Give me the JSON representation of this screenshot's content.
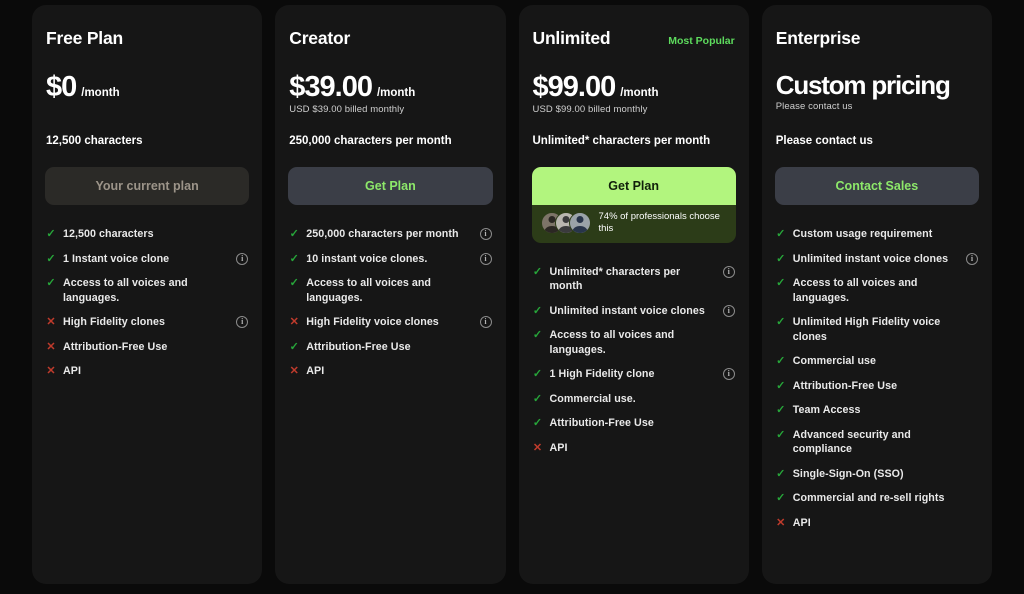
{
  "page": {
    "background": "#0a0a0a",
    "card_background": "#161616",
    "accent_green": "#b2f57e",
    "badge_green": "#5ddb5d",
    "check_green": "#27a63a",
    "cross_red": "#bf3b2c"
  },
  "plans": [
    {
      "name": "Free Plan",
      "badge": "",
      "price": "$0",
      "period": "/month",
      "price_sub": "",
      "quota": "12,500 characters",
      "cta_label": "Your current plan",
      "cta_style": "disabled",
      "social_proof": null,
      "features": [
        {
          "mark": "yes",
          "text": "12,500 characters",
          "info": false
        },
        {
          "mark": "yes",
          "text": "1 Instant voice clone",
          "info": true
        },
        {
          "mark": "yes",
          "text": "Access to all voices and languages.",
          "info": false
        },
        {
          "mark": "no",
          "text": "High Fidelity clones",
          "info": true
        },
        {
          "mark": "no",
          "text": "Attribution-Free Use",
          "info": false
        },
        {
          "mark": "no",
          "text": "API",
          "info": false
        }
      ]
    },
    {
      "name": "Creator",
      "badge": "",
      "price": "$39.00",
      "period": "/month",
      "price_sub": "USD $39.00 billed monthly",
      "quota": "250,000 characters per month",
      "cta_label": "Get Plan",
      "cta_style": "neutral",
      "social_proof": null,
      "features": [
        {
          "mark": "yes",
          "text": "250,000 characters per month",
          "info": true
        },
        {
          "mark": "yes",
          "text": "10 instant voice clones.",
          "info": true
        },
        {
          "mark": "yes",
          "text": "Access to all voices and languages.",
          "info": false
        },
        {
          "mark": "no",
          "text": "High Fidelity voice clones",
          "info": true
        },
        {
          "mark": "yes",
          "text": "Attribution-Free Use",
          "info": false
        },
        {
          "mark": "no",
          "text": "API",
          "info": false
        }
      ]
    },
    {
      "name": "Unlimited",
      "badge": "Most Popular",
      "price": "$99.00",
      "period": "/month",
      "price_sub": "USD $99.00 billed monthly",
      "quota": "Unlimited* characters per month",
      "cta_label": "Get Plan",
      "cta_style": "primary",
      "social_proof": "74% of professionals choose this",
      "features": [
        {
          "mark": "yes",
          "text": "Unlimited* characters per month",
          "info": true
        },
        {
          "mark": "yes",
          "text": "Unlimited instant voice clones",
          "info": true
        },
        {
          "mark": "yes",
          "text": "Access to all voices and languages.",
          "info": false
        },
        {
          "mark": "yes",
          "text": "1 High Fidelity clone",
          "info": true
        },
        {
          "mark": "yes",
          "text": "Commercial use.",
          "info": false
        },
        {
          "mark": "yes",
          "text": "Attribution-Free Use",
          "info": false
        },
        {
          "mark": "no",
          "text": "API",
          "info": false
        }
      ]
    },
    {
      "name": "Enterprise",
      "badge": "",
      "price": "Custom pricing",
      "period": "",
      "price_sub": "Please contact us",
      "quota": "Please contact us",
      "cta_label": "Contact Sales",
      "cta_style": "neutral",
      "social_proof": null,
      "features": [
        {
          "mark": "yes",
          "text": "Custom usage requirement",
          "info": false
        },
        {
          "mark": "yes",
          "text": "Unlimited instant voice clones",
          "info": true
        },
        {
          "mark": "yes",
          "text": "Access to all voices and languages.",
          "info": false
        },
        {
          "mark": "yes",
          "text": "Unlimited High Fidelity voice clones",
          "info": false
        },
        {
          "mark": "yes",
          "text": "Commercial use",
          "info": false
        },
        {
          "mark": "yes",
          "text": "Attribution-Free Use",
          "info": false
        },
        {
          "mark": "yes",
          "text": "Team Access",
          "info": false
        },
        {
          "mark": "yes",
          "text": "Advanced security and compliance",
          "info": false
        },
        {
          "mark": "yes",
          "text": "Single-Sign-On (SSO)",
          "info": false
        },
        {
          "mark": "yes",
          "text": "Commercial and re-sell rights",
          "info": false
        },
        {
          "mark": "no",
          "text": "API",
          "info": false
        }
      ]
    }
  ],
  "icons": {
    "info": "i",
    "check": "✓",
    "cross": "✕"
  }
}
